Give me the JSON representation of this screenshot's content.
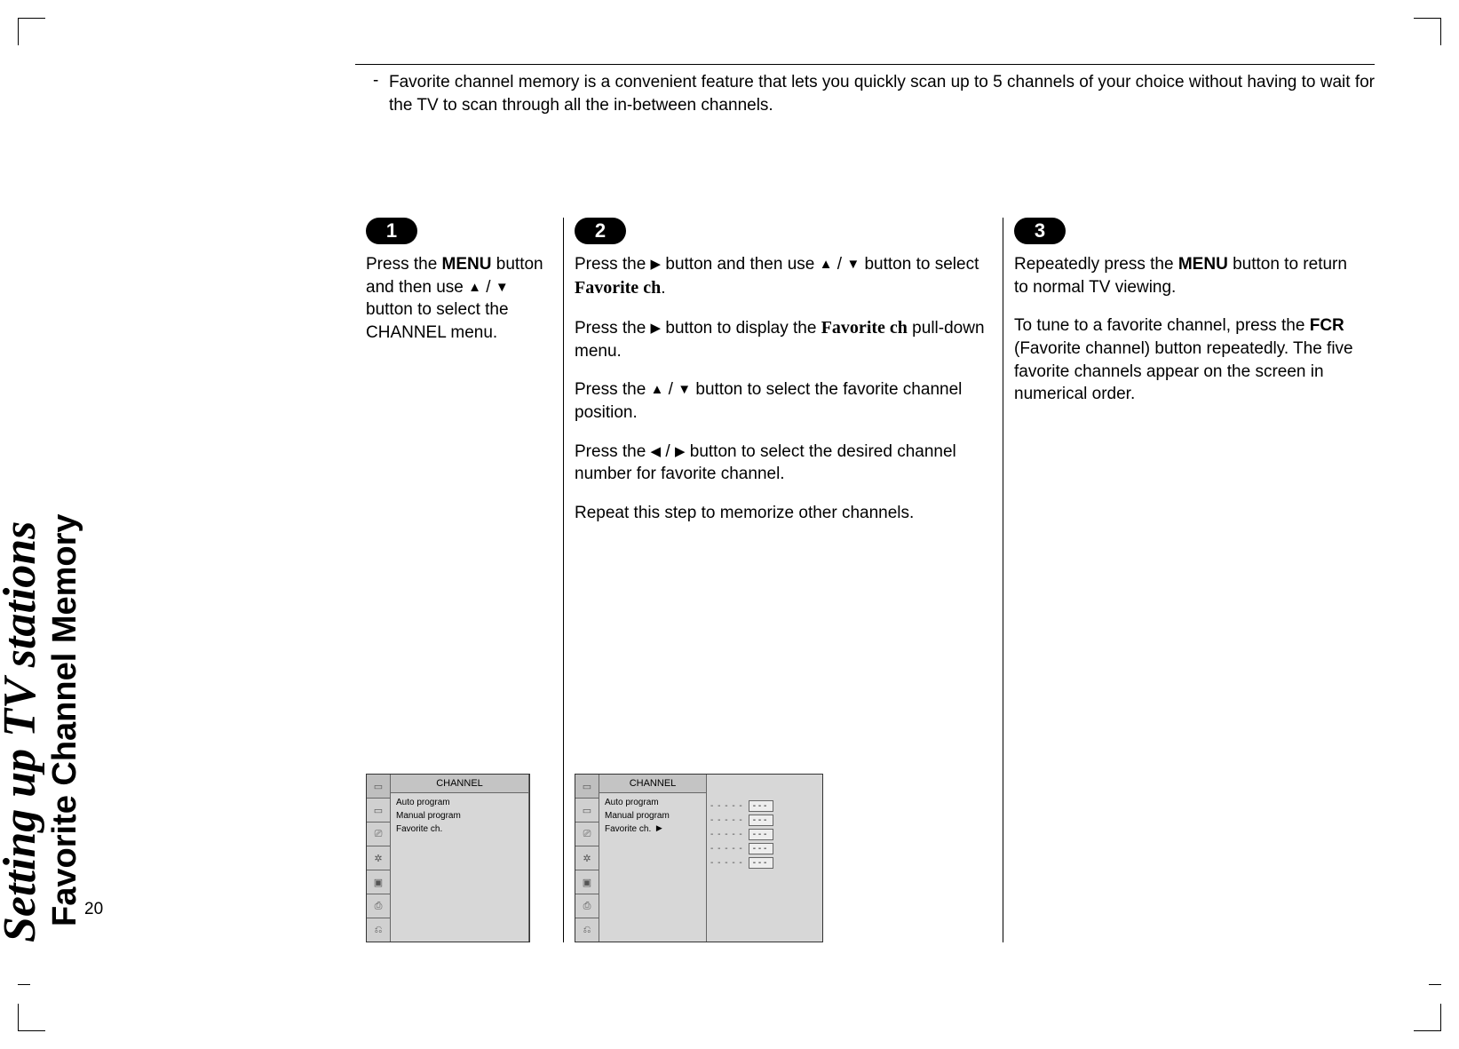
{
  "page_number": "20",
  "side_title": {
    "main": "Setting up TV stations",
    "sub": "Favorite Channel Memory"
  },
  "intro": {
    "bullet": "-",
    "text": "Favorite channel memory is a convenient feature that lets you quickly scan up to 5 channels of your choice without having to wait for the TV to scan through all the in-between channels."
  },
  "arrows": {
    "up": "▲",
    "down": "▼",
    "left": "◀",
    "right": "▶"
  },
  "steps": [
    {
      "num": "1",
      "p1_a": "Press the ",
      "p1_menu": "MENU",
      "p1_b": " button and then use ",
      "p1_c": " / ",
      "p1_d": " button to select the CHANNEL menu."
    },
    {
      "num": "2",
      "p1_a": "Press the ",
      "p1_b": " button and then use ",
      "p1_c": " / ",
      "p1_d": " button to select ",
      "p1_fav": "Favorite ch",
      "p1_e": ".",
      "p2_a": "Press the ",
      "p2_b": " button to display the ",
      "p2_fav": "Favorite ch",
      "p2_c": " pull-down menu.",
      "p3_a": "Press the ",
      "p3_b": " / ",
      "p3_c": " button to select the favorite channel position.",
      "p4_a": "Press the ",
      "p4_b": " / ",
      "p4_c": " button to select the desired channel number for favorite channel.",
      "p5": "Repeat this step to memorize other channels."
    },
    {
      "num": "3",
      "p1_a": "Repeatedly press the ",
      "p1_menu": "MENU",
      "p1_b": " button to return to normal TV viewing.",
      "p2_a": "To tune to a favorite channel, press the ",
      "p2_fcr": "FCR",
      "p2_b": " (Favorite channel) button repeatedly. The five favorite channels appear on the screen in numerical order."
    }
  ],
  "osd": {
    "title": "CHANNEL",
    "items": [
      "Auto program",
      "Manual program",
      "Favorite ch."
    ],
    "fav_arrow": "▶",
    "sub_rows": [
      {
        "dots": "- - - - -",
        "val": "- - -"
      },
      {
        "dots": "- - - - -",
        "val": "- - -"
      },
      {
        "dots": "- - - - -",
        "val": "- - -"
      },
      {
        "dots": "- - - - -",
        "val": "- - -"
      },
      {
        "dots": "- - - - -",
        "val": "- - -"
      }
    ],
    "icons": [
      "▭",
      "▭",
      "⎚",
      "✲",
      "▣",
      "⎙",
      "⎌"
    ]
  }
}
